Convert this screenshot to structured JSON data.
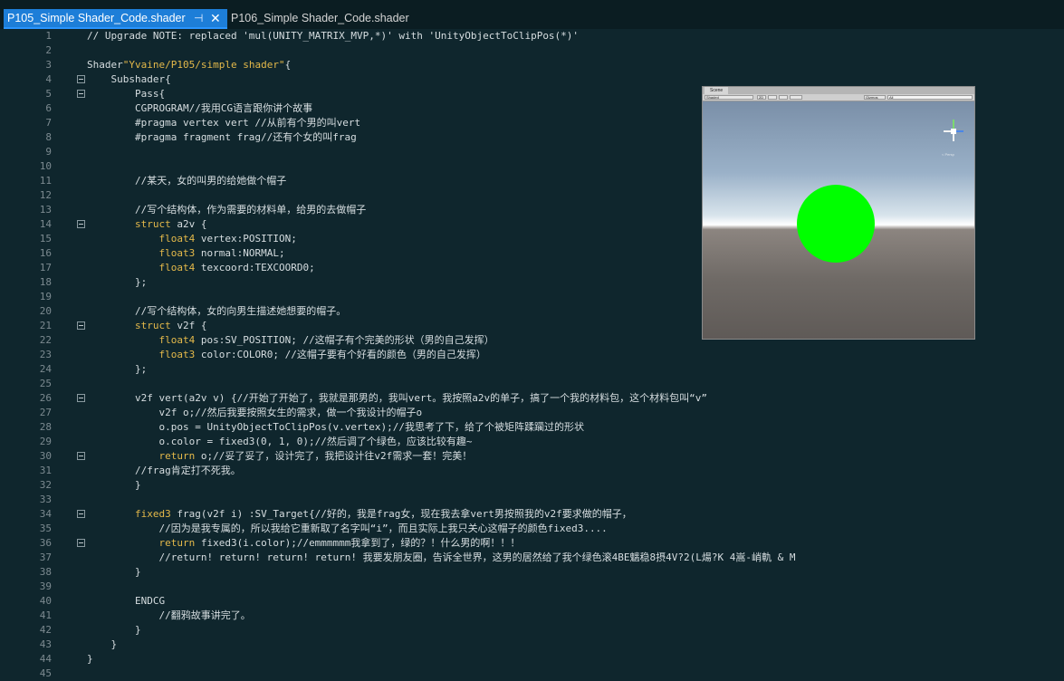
{
  "tabs": [
    {
      "label": "P105_Simple Shader_Code.shader",
      "active": true
    },
    {
      "label": "P106_Simple Shader_Code.shader",
      "active": false
    }
  ],
  "icons": {
    "pin": "pin-icon",
    "close": "close-icon"
  },
  "colors": {
    "background": "#0f262d",
    "active_tab": "#1d7ed8",
    "keyword": "#e4b94a",
    "text": "#d6dde0",
    "sphere": "#00ff00"
  },
  "lines": [
    {
      "n": "1",
      "text": "// Upgrade NOTE: replaced 'mul(UNITY_MATRIX_MVP,*)' with 'UnityObjectToClipPos(*)'"
    },
    {
      "n": "2",
      "text": ""
    },
    {
      "n": "3",
      "text": "Shader\"Yvaine/P105/simple shader\"{"
    },
    {
      "n": "4",
      "text": "    Subshader{"
    },
    {
      "n": "5",
      "text": "        Pass{"
    },
    {
      "n": "6",
      "text": "        CGPROGRAM//我用CG语言跟你讲个故事"
    },
    {
      "n": "7",
      "text": "        #pragma vertex vert //从前有个男的叫vert"
    },
    {
      "n": "8",
      "text": "        #pragma fragment frag//还有个女的叫frag"
    },
    {
      "n": "9",
      "text": ""
    },
    {
      "n": "10",
      "text": ""
    },
    {
      "n": "11",
      "text": "        //某天，女的叫男的给她做个帽子"
    },
    {
      "n": "12",
      "text": ""
    },
    {
      "n": "13",
      "text": "        //写个结构体，作为需要的材料单，给男的去做帽子"
    },
    {
      "n": "14",
      "text": "        struct a2v {"
    },
    {
      "n": "15",
      "text": "            float4 vertex:POSITION;"
    },
    {
      "n": "16",
      "text": "            float3 normal:NORMAL;"
    },
    {
      "n": "17",
      "text": "            float4 texcoord:TEXCOORD0;"
    },
    {
      "n": "18",
      "text": "        };"
    },
    {
      "n": "19",
      "text": ""
    },
    {
      "n": "20",
      "text": "        //写个结构体，女的向男生描述她想要的帽子。"
    },
    {
      "n": "21",
      "text": "        struct v2f {"
    },
    {
      "n": "22",
      "text": "            float4 pos:SV_POSITION; //这帽子有个完美的形状（男的自己发挥）"
    },
    {
      "n": "23",
      "text": "            float3 color:COLOR0; //这帽子要有个好看的颜色（男的自己发挥）"
    },
    {
      "n": "24",
      "text": "        };"
    },
    {
      "n": "25",
      "text": ""
    },
    {
      "n": "26",
      "text": "        v2f vert(a2v v) {//开始了开始了，我就是那男的，我叫vert。我按照a2v的单子，搞了一个我的材料包，这个材料包叫“v”"
    },
    {
      "n": "27",
      "text": "            v2f o;//然后我要按照女生的需求，做一个我设计的帽子o"
    },
    {
      "n": "28",
      "text": "            o.pos = UnityObjectToClipPos(v.vertex);//我思考了下，给了个被矩阵蹂躏过的形状"
    },
    {
      "n": "29",
      "text": "            o.color = fixed3(0, 1, 0);//然后调了个绿色，应该比较有趣~"
    },
    {
      "n": "30",
      "text": "            return o;//妥了妥了，设计完了，我把设计往v2f需求一套！完美！"
    },
    {
      "n": "31",
      "text": "        //frag肯定打不死我。"
    },
    {
      "n": "32",
      "text": "        }"
    },
    {
      "n": "33",
      "text": ""
    },
    {
      "n": "34",
      "text": "        fixed3 frag(v2f i) :SV_Target{//好的，我是frag女，现在我去拿vert男按照我的v2f要求做的帽子，"
    },
    {
      "n": "35",
      "text": "            //因为是我专属的，所以我给它重新取了名字叫“i”，而且实际上我只关心这帽子的颜色fixed3...."
    },
    {
      "n": "36",
      "text": "            return fixed3(i.color);//emmmmmm我拿到了，绿的？！什么男的啊！！！"
    },
    {
      "n": "37",
      "text": "            //return! return! return! return! 我要发朋友圈，告诉全世界，这男的居然给了我个绿色滚4BE魑稳8摂4V?2(L煬?K 4嵩-峭軌 & M"
    },
    {
      "n": "38",
      "text": "        }"
    },
    {
      "n": "39",
      "text": ""
    },
    {
      "n": "40",
      "text": "        ENDCG"
    },
    {
      "n": "41",
      "text": "            //翻鸦故事讲完了。"
    },
    {
      "n": "42",
      "text": "        }"
    },
    {
      "n": "43",
      "text": "    }"
    },
    {
      "n": "44",
      "text": "}"
    },
    {
      "n": "45",
      "text": ""
    }
  ],
  "scene": {
    "tab_label": "Scene",
    "shading_mode": "Shaded",
    "mode_2d": "2D",
    "gizmos_label": "Gizmos",
    "search_placeholder": "All",
    "persp_label": "< Persp"
  }
}
